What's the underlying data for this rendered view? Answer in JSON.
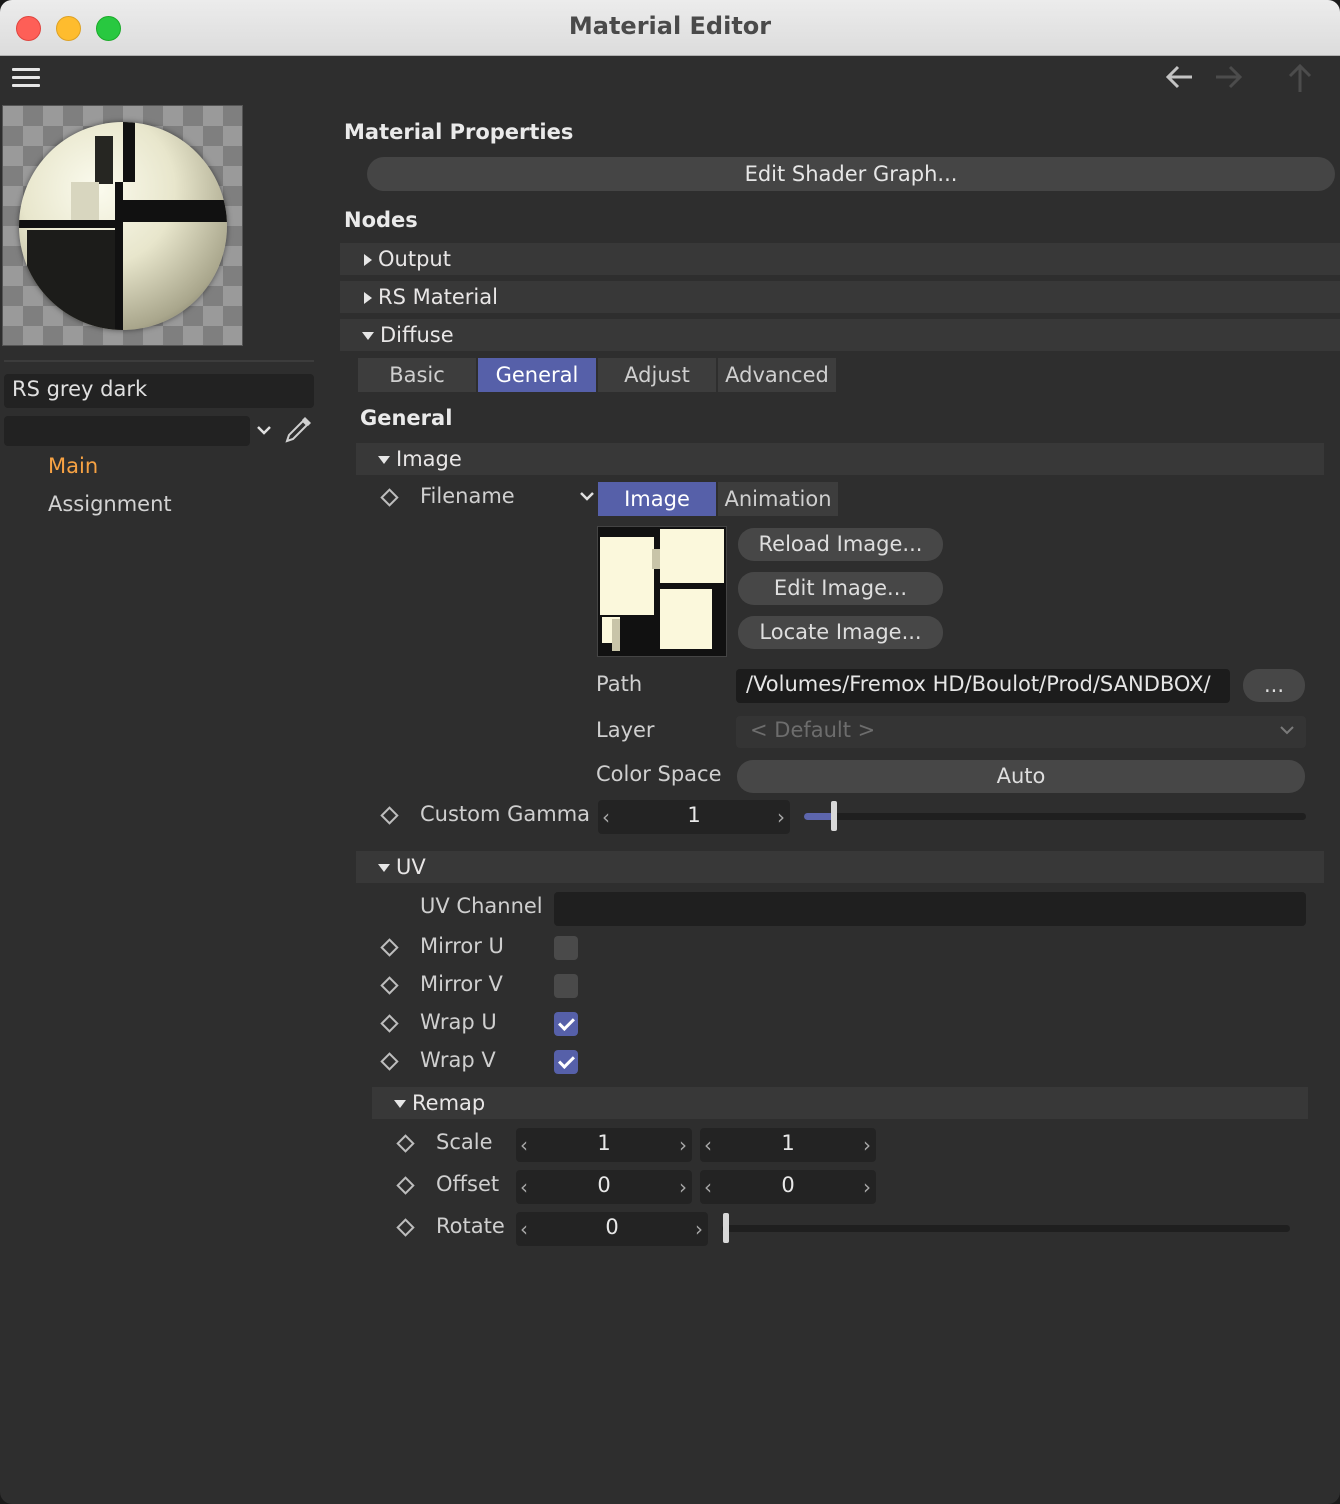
{
  "window": {
    "title": "Material Editor"
  },
  "sidebar": {
    "material_name": "RS grey dark",
    "nav": [
      {
        "label": "Main",
        "active": true
      },
      {
        "label": "Assignment",
        "active": false
      }
    ]
  },
  "main": {
    "title": "Material Properties",
    "edit_shader_label": "Edit Shader Graph...",
    "nodes_heading": "Nodes",
    "node_sections": {
      "output": "Output",
      "rs_material": "RS Material",
      "diffuse": "Diffuse"
    },
    "tabs": [
      "Basic",
      "General",
      "Adjust",
      "Advanced"
    ],
    "active_tab": "General",
    "general_heading": "General",
    "image_section": {
      "title": "Image",
      "filename_label": "Filename",
      "subtabs": [
        "Image",
        "Animation"
      ],
      "active_subtab": "Image",
      "buttons": {
        "reload": "Reload Image...",
        "edit": "Edit Image...",
        "locate": "Locate Image..."
      },
      "path_label": "Path",
      "path_value": "/Volumes/Fremox HD/Boulot/Prod/SANDBOX/",
      "browse_label": "...",
      "layer_label": "Layer",
      "layer_value": "< Default >",
      "colorspace_label": "Color Space",
      "colorspace_value": "Auto",
      "gamma_label": "Custom Gamma",
      "gamma_value": "1",
      "gamma_slider_fraction": 0.06
    },
    "uv_section": {
      "title": "UV",
      "uv_channel_label": "UV Channel",
      "uv_channel_value": "",
      "mirror_u_label": "Mirror U",
      "mirror_u": false,
      "mirror_v_label": "Mirror V",
      "mirror_v": false,
      "wrap_u_label": "Wrap U",
      "wrap_u": true,
      "wrap_v_label": "Wrap V",
      "wrap_v": true
    },
    "remap_section": {
      "title": "Remap",
      "scale_label": "Scale",
      "scale_u": "1",
      "scale_v": "1",
      "offset_label": "Offset",
      "offset_u": "0",
      "offset_v": "0",
      "rotate_label": "Rotate",
      "rotate_value": "0",
      "rotate_slider_fraction": 0.0
    }
  },
  "icons": {
    "back": "arrow-left-icon",
    "forward": "arrow-right-icon",
    "up": "arrow-up-icon",
    "menu": "hamburger-icon",
    "eyedropper": "eyedropper-icon",
    "keyframe": "diamond-keyframe-icon"
  },
  "colors": {
    "accent": "#5660a9",
    "active_nav": "#f7a243",
    "panel": "#2e2e2e"
  }
}
